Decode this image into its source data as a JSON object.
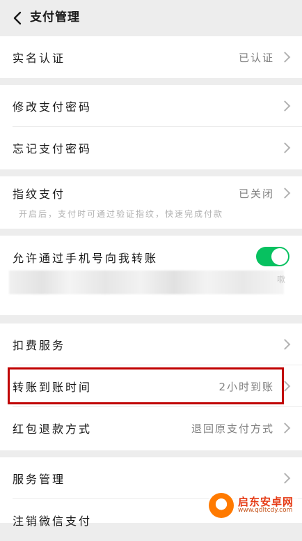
{
  "header": {
    "title": "支付管理"
  },
  "sections": {
    "real_name": {
      "label": "实名认证",
      "value": "已认证"
    },
    "change_pwd": {
      "label": "修改支付密码"
    },
    "forgot_pwd": {
      "label": "忘记支付密码"
    },
    "fingerprint": {
      "label": "指纹支付",
      "value": "已关闭",
      "description": "开启后，支付时可通过验证指纹，快速完成付款"
    },
    "phone_transfer": {
      "label": "允许通过手机号向我转账",
      "toggle_on": true,
      "blurred_tail": "嗽"
    },
    "deduct": {
      "label": "扣费服务"
    },
    "transfer_time": {
      "label": "转账到账时间",
      "value": "2小时到账"
    },
    "red_packet": {
      "label": "红包退款方式",
      "value": "退回原支付方式"
    },
    "service_mgmt": {
      "label": "服务管理"
    },
    "cancel": {
      "label": "注销微信支付"
    }
  },
  "watermark": {
    "name": "启东安卓网",
    "url": "www.qdltcdy.com"
  },
  "colors": {
    "accent": "#07c160",
    "highlight": "#c00000"
  }
}
